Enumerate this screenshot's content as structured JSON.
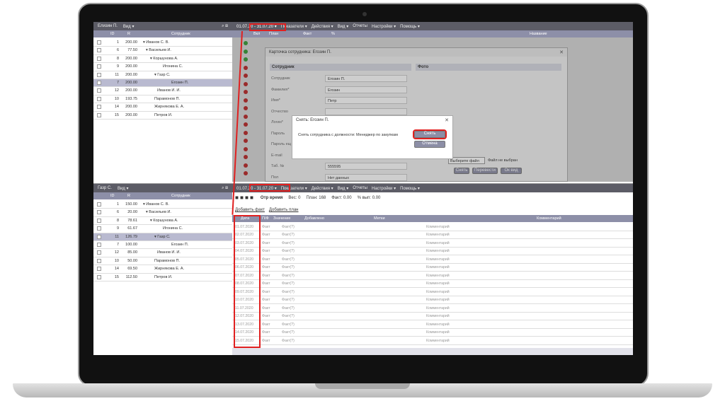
{
  "top_pane": {
    "user_label": "Елизин П.",
    "view_label": "Вид ▾",
    "columns": [
      "ID",
      "R",
      "Сотрудник"
    ],
    "rows": [
      {
        "id": "1",
        "r": "200.00",
        "name": "▾ Иванов С. В."
      },
      {
        "id": "6",
        "r": "77.50",
        "name": "▾ Васильев И."
      },
      {
        "id": "8",
        "r": "200.00",
        "name": "▾ Коршунова А."
      },
      {
        "id": "9",
        "r": "200.00",
        "name": "Игонина С."
      },
      {
        "id": "11",
        "r": "200.00",
        "name": "▾ Газр С."
      },
      {
        "id": "7",
        "r": "200.00",
        "name": "Егозин П."
      },
      {
        "id": "12",
        "r": "200.00",
        "name": "Иванов И. И."
      },
      {
        "id": "10",
        "r": "193.75",
        "name": "Парамонов П."
      },
      {
        "id": "14",
        "r": "200.00",
        "name": "Жирнякова Е. А."
      },
      {
        "id": "15",
        "r": "200.00",
        "name": "Петров И."
      }
    ],
    "menu": [
      "01.07.20 - 31.07.20 ▾",
      "Показатели ▾",
      "Действия ▾",
      "Вид ▾",
      "Отчеты",
      "Настройки ▾",
      "Помощь ▾"
    ],
    "grid_headers": [
      "Вкл",
      "План",
      "Факт",
      "%",
      "Название"
    ]
  },
  "card_dialog": {
    "title": "Карточка сотрудника: Егозин П.",
    "section_employee": "Сотрудник",
    "section_photo": "Фото",
    "fields": [
      {
        "label": "Сотрудник",
        "value": "Егозин П."
      },
      {
        "label": "Фамилия*",
        "value": "Егозин"
      },
      {
        "label": "Имя*",
        "value": "Петр"
      },
      {
        "label": "Отчество",
        "value": ""
      },
      {
        "label": "Логин*",
        "value": ""
      },
      {
        "label": "Пароль",
        "value": ""
      },
      {
        "label": "Пароль ещ",
        "value": ""
      },
      {
        "label": "E-mail",
        "value": ""
      },
      {
        "label": "Таб. №",
        "value": "555595"
      },
      {
        "label": "Пол",
        "value": "Нет данных"
      }
    ],
    "choose_file": "Выберите файл",
    "no_file": "Файл не выбран",
    "photo_buttons": [
      "Снять",
      "Перевести",
      "Ок вид"
    ]
  },
  "confirm_dialog": {
    "title": "Снять: Егозин П.",
    "message": "Снять сотрудника с должности: Менеджер по закупкам",
    "ok": "Снять",
    "cancel": "Отмена"
  },
  "bottom_left": {
    "user_label": "Газр С.",
    "view_label": "Вид ▾",
    "columns": [
      "ID",
      "R",
      "Сотрудник"
    ],
    "rows": [
      {
        "id": "1",
        "r": "150.00",
        "name": "▾ Иванов С. В."
      },
      {
        "id": "6",
        "r": "20.00",
        "name": "▾ Васильев И."
      },
      {
        "id": "8",
        "r": "78.61",
        "name": "▾ Коршунова А."
      },
      {
        "id": "9",
        "r": "61.67",
        "name": "Игонина С."
      },
      {
        "id": "11",
        "r": "126.79",
        "name": "▾ Газр С."
      },
      {
        "id": "7",
        "r": "100.00",
        "name": "Егозин П."
      },
      {
        "id": "12",
        "r": "85.00",
        "name": "Иванов И. И."
      },
      {
        "id": "10",
        "r": "50.00",
        "name": "Парамонов П."
      },
      {
        "id": "14",
        "r": "69.50",
        "name": "Жирнякова Е. А."
      },
      {
        "id": "15",
        "r": "112.50",
        "name": "Петров И."
      }
    ]
  },
  "bottom_right": {
    "menu": [
      "01.07.20 - 31.07.20 ▾",
      "Показатели ▾",
      "Действия ▾",
      "Вид ▾",
      "Отчеты",
      "Настройки ▾",
      "Помощь ▾"
    ],
    "summary": {
      "label": "Отр время",
      "weight": "Вес: 0",
      "plan": "План: 168",
      "fact": "Факт: 0.00",
      "pct": "% вып: 0.00"
    },
    "links": [
      "Добавить факт",
      "Добавить план"
    ],
    "columns": [
      "Дата",
      "П/Ф",
      "Значение",
      "Добавлено",
      "Метки",
      "Комментарий"
    ],
    "rows": [
      {
        "date": "01.07.2020",
        "pf": "Факт",
        "val": "Факт(?)",
        "comment": "Комментарий"
      },
      {
        "date": "02.07.2020",
        "pf": "Факт",
        "val": "Факт(?)",
        "comment": "Комментарий"
      },
      {
        "date": "03.07.2020",
        "pf": "Факт",
        "val": "Факт(?)",
        "comment": "Комментарий"
      },
      {
        "date": "04.07.2020",
        "pf": "Факт",
        "val": "Факт(?)",
        "comment": "Комментарий"
      },
      {
        "date": "05.07.2020",
        "pf": "Факт",
        "val": "Факт(?)",
        "comment": "Комментарий"
      },
      {
        "date": "06.07.2020",
        "pf": "Факт",
        "val": "Факт(?)",
        "comment": "Комментарий"
      },
      {
        "date": "07.07.2020",
        "pf": "Факт",
        "val": "Факт(?)",
        "comment": "Комментарий"
      },
      {
        "date": "08.07.2020",
        "pf": "Факт",
        "val": "Факт(?)",
        "comment": "Комментарий"
      },
      {
        "date": "09.07.2020",
        "pf": "Факт",
        "val": "Факт(?)",
        "comment": "Комментарий"
      },
      {
        "date": "10.07.2020",
        "pf": "Факт",
        "val": "Факт(?)",
        "comment": "Комментарий"
      },
      {
        "date": "11.07.2020",
        "pf": "Факт",
        "val": "Факт(?)",
        "comment": "Комментарий"
      },
      {
        "date": "12.07.2020",
        "pf": "Факт",
        "val": "Факт(?)",
        "comment": "Комментарий"
      },
      {
        "date": "13.07.2020",
        "pf": "Факт",
        "val": "Факт(?)",
        "comment": "Комментарий"
      },
      {
        "date": "14.07.2020",
        "pf": "Факт",
        "val": "Факт(?)",
        "comment": "Комментарий"
      },
      {
        "date": "15.07.2020",
        "pf": "Факт",
        "val": "Факт(?)",
        "comment": "Комментарий"
      }
    ]
  },
  "colors": {
    "accent": "#8d8fa8",
    "highlight": "#e02020",
    "selected": "#b9bad0"
  }
}
